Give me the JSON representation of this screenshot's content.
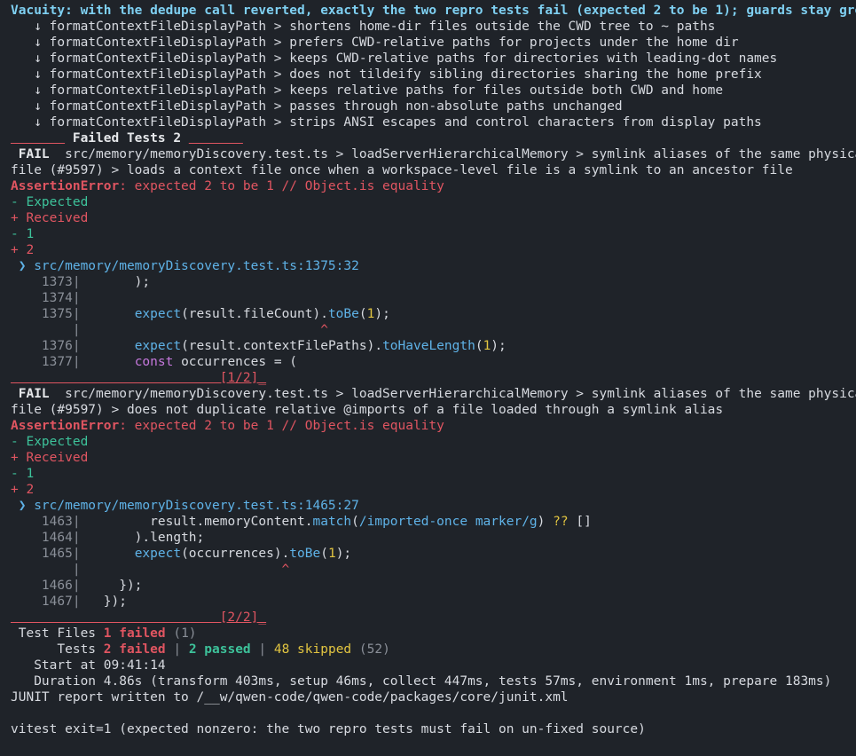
{
  "banner": "Vacuity: with the dedupe call reverted, exactly the two repro tests fail (expected 2 to be 1); guards stay green",
  "skipped_tests": [
    "   ↓ formatContextFileDisplayPath > shortens home-dir files outside the CWD tree to ~ paths",
    "   ↓ formatContextFileDisplayPath > prefers CWD-relative paths for projects under the home dir",
    "   ↓ formatContextFileDisplayPath > keeps CWD-relative paths for directories with leading-dot names",
    "   ↓ formatContextFileDisplayPath > does not tildeify sibling directories sharing the home prefix",
    "   ↓ formatContextFileDisplayPath > keeps relative paths for files outside both CWD and home",
    "   ↓ formatContextFileDisplayPath > passes through non-absolute paths unchanged",
    "   ↓ formatContextFileDisplayPath > strips ANSI escapes and control characters from display paths"
  ],
  "failed_header": {
    "left": "       ",
    "title": " Failed Tests 2 ",
    "right": "       "
  },
  "failures": [
    {
      "badge": " FAIL ",
      "title_line1": " src/memory/memoryDiscovery.test.ts > loadServerHierarchicalMemory > symlink aliases of the same physical",
      "title_line2": "file (#9597) > loads a context file once when a workspace-level file is a symlink to an ancestor file",
      "error_name": "AssertionError",
      "error_msg": ": expected 2 to be 1 // Object.is equality",
      "diff": [
        "- Expected",
        "+ Received",
        "- 1",
        "+ 2"
      ],
      "location": " ❯ src/memory/memoryDiscovery.test.ts:1375:32",
      "code": [
        {
          "num": "    1373|",
          "code": "       );"
        },
        {
          "num": "    1374|",
          "code": ""
        },
        {
          "num": "    1375|",
          "code": "       expect(result.fileCount).toBe(1);"
        },
        {
          "num": "        |",
          "code": "                               ^"
        },
        {
          "num": "    1376|",
          "code": "       expect(result.contextFilePaths).toHaveLength(1);"
        },
        {
          "num": "    1377|",
          "code": "       const occurrences = ("
        }
      ],
      "rule": "                           [1/2]_"
    },
    {
      "badge": " FAIL ",
      "title_line1": " src/memory/memoryDiscovery.test.ts > loadServerHierarchicalMemory > symlink aliases of the same physical",
      "title_line2": "file (#9597) > does not duplicate relative @imports of a file loaded through a symlink alias",
      "error_name": "AssertionError",
      "error_msg": ": expected 2 to be 1 // Object.is equality",
      "diff": [
        "- Expected",
        "+ Received",
        "- 1",
        "+ 2"
      ],
      "location": " ❯ src/memory/memoryDiscovery.test.ts:1465:27",
      "code": [
        {
          "num": "    1463|",
          "code": "         result.memoryContent.match(/imported-once marker/g) ?? []"
        },
        {
          "num": "    1464|",
          "code": "       ).length;"
        },
        {
          "num": "    1465|",
          "code": "       expect(occurrences).toBe(1);"
        },
        {
          "num": "        |",
          "code": "                          ^"
        },
        {
          "num": "    1466|",
          "code": "     });"
        },
        {
          "num": "    1467|",
          "code": "   });"
        }
      ],
      "rule": "                           [2/2]_"
    }
  ],
  "summary": {
    "test_files_label": " Test Files ",
    "test_files_failed": "1 failed",
    "test_files_total": "(1)",
    "tests_label": "      Tests ",
    "tests_failed": "2 failed",
    "tests_sep": " | ",
    "tests_passed": "2 passed",
    "tests_skipped": "48 skipped",
    "tests_total": "(52)",
    "start_label": "   Start at ",
    "start_value": "09:41:14",
    "duration_label": "   Duration ",
    "duration_value": "4.86s (transform 403ms, setup 46ms, collect 447ms, tests 57ms, environment 1ms, prepare 183ms)"
  },
  "junit": "JUNIT report written to /__w/qwen-code/qwen-code/packages/core/junit.xml",
  "exit_line": "vitest exit=1 (expected nonzero: the two repro tests must fail on un-fixed source)"
}
